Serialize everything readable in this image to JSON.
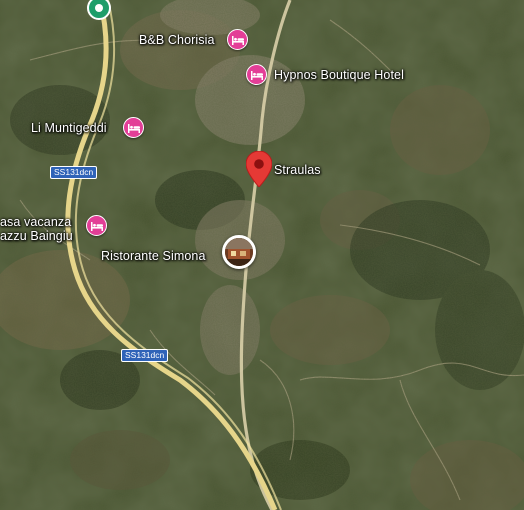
{
  "map": {
    "type": "satellite",
    "place_labels": {
      "bb_chorisia": "B&B Chorisia",
      "hypnos": "Hypnos Boutique Hotel",
      "li_muntigeddi": "Li Muntigeddi",
      "straulas": "Straulas",
      "casa_vacanza": "asa vacanza",
      "azzu_baingiu": "azzu Baingiu",
      "ristorante": "Ristorante Simona"
    },
    "road_shields": {
      "ss131_upper": "SS131dcn",
      "ss131_lower": "SS131dcn"
    },
    "icons": {
      "hotel": "hotel-bed-icon",
      "pin": "red-map-pin-icon",
      "restaurant": "restaurant-photo-icon",
      "top_marker": "green-location-icon"
    },
    "colors": {
      "hotel_pin": "#e33e97",
      "main_pin": "#e53935",
      "highway": "#e6d58a",
      "shield": "#2f63b8",
      "top_marker": "#1e9e6a"
    }
  }
}
